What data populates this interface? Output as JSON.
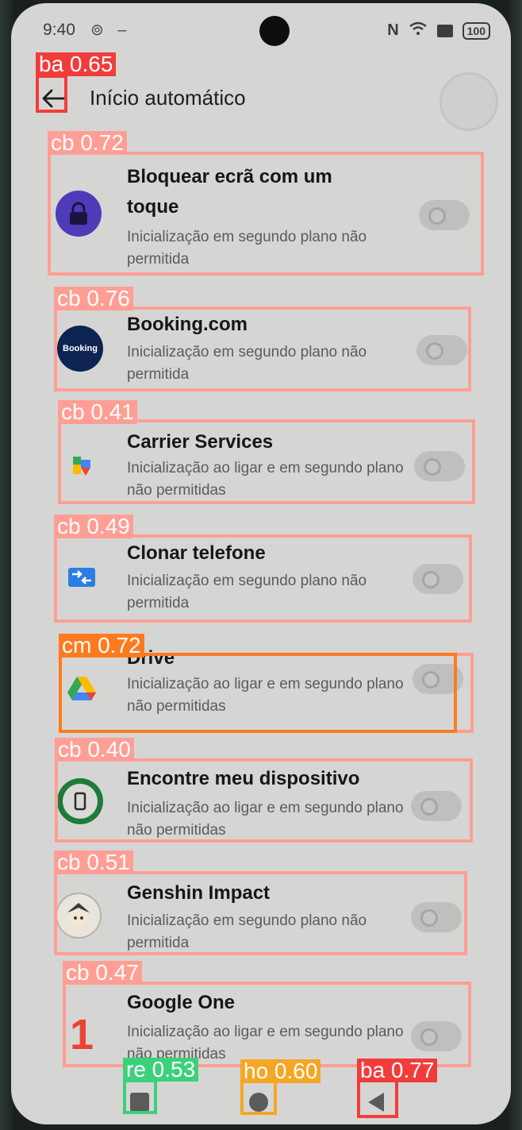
{
  "status_bar": {
    "time": "9:40",
    "left_icons": "⊚ –",
    "nfc": "N",
    "battery": "100"
  },
  "header": {
    "title": "Início automático"
  },
  "apps": [
    {
      "name": "Bloquear ecrã com um toque",
      "desc": "Inicialização em segundo plano não permitida",
      "icon": "lock-app-icon",
      "enabled": false
    },
    {
      "name": "Booking.com",
      "desc": "Inicialização em segundo plano não permitida",
      "icon": "booking-icon",
      "icon_text": "Booking",
      "enabled": false
    },
    {
      "name": "Carrier Services",
      "desc": "Inicialização ao ligar e em segundo plano não permitidas",
      "icon": "carrier-services-icon",
      "enabled": false
    },
    {
      "name": "Clonar telefone",
      "desc": "Inicialização em segundo plano não permitida",
      "icon": "clone-phone-icon",
      "enabled": false
    },
    {
      "name": "Drive",
      "desc": "Inicialização ao ligar e em segundo plano não permitidas",
      "icon": "drive-icon",
      "enabled": false
    },
    {
      "name": "Encontre meu dispositivo",
      "desc": "Inicialização ao ligar e em segundo plano não permitidas",
      "icon": "find-device-icon",
      "enabled": false
    },
    {
      "name": "Genshin Impact",
      "desc": "Inicialização em segundo plano não permitida",
      "icon": "genshin-icon",
      "enabled": false
    },
    {
      "name": "Google One",
      "desc": "Inicialização ao ligar e em segundo plano não permitidas",
      "icon": "google-one-icon",
      "icon_text": "1",
      "enabled": false
    }
  ],
  "detections": [
    {
      "label": "ba 0.65",
      "color": "#f23c3c"
    },
    {
      "label": "cb 0.72",
      "color": "#ff9e94"
    },
    {
      "label": "cb 0.76",
      "color": "#ff9e94"
    },
    {
      "label": "cb 0.41",
      "color": "#ff9e94"
    },
    {
      "label": "cb 0.49",
      "color": "#ff9e94"
    },
    {
      "label": "cm 0.72",
      "color": "#ff7a1e"
    },
    {
      "label": "cb 0.40",
      "color": "#ff9e94"
    },
    {
      "label": "cb 0.51",
      "color": "#ff9e94"
    },
    {
      "label": "cb 0.47",
      "color": "#ff9e94"
    },
    {
      "label": "re 0.53",
      "color": "#3bd17a"
    },
    {
      "label": "ho 0.60",
      "color": "#f5a623"
    },
    {
      "label": "ba 0.77",
      "color": "#f23c3c"
    }
  ]
}
